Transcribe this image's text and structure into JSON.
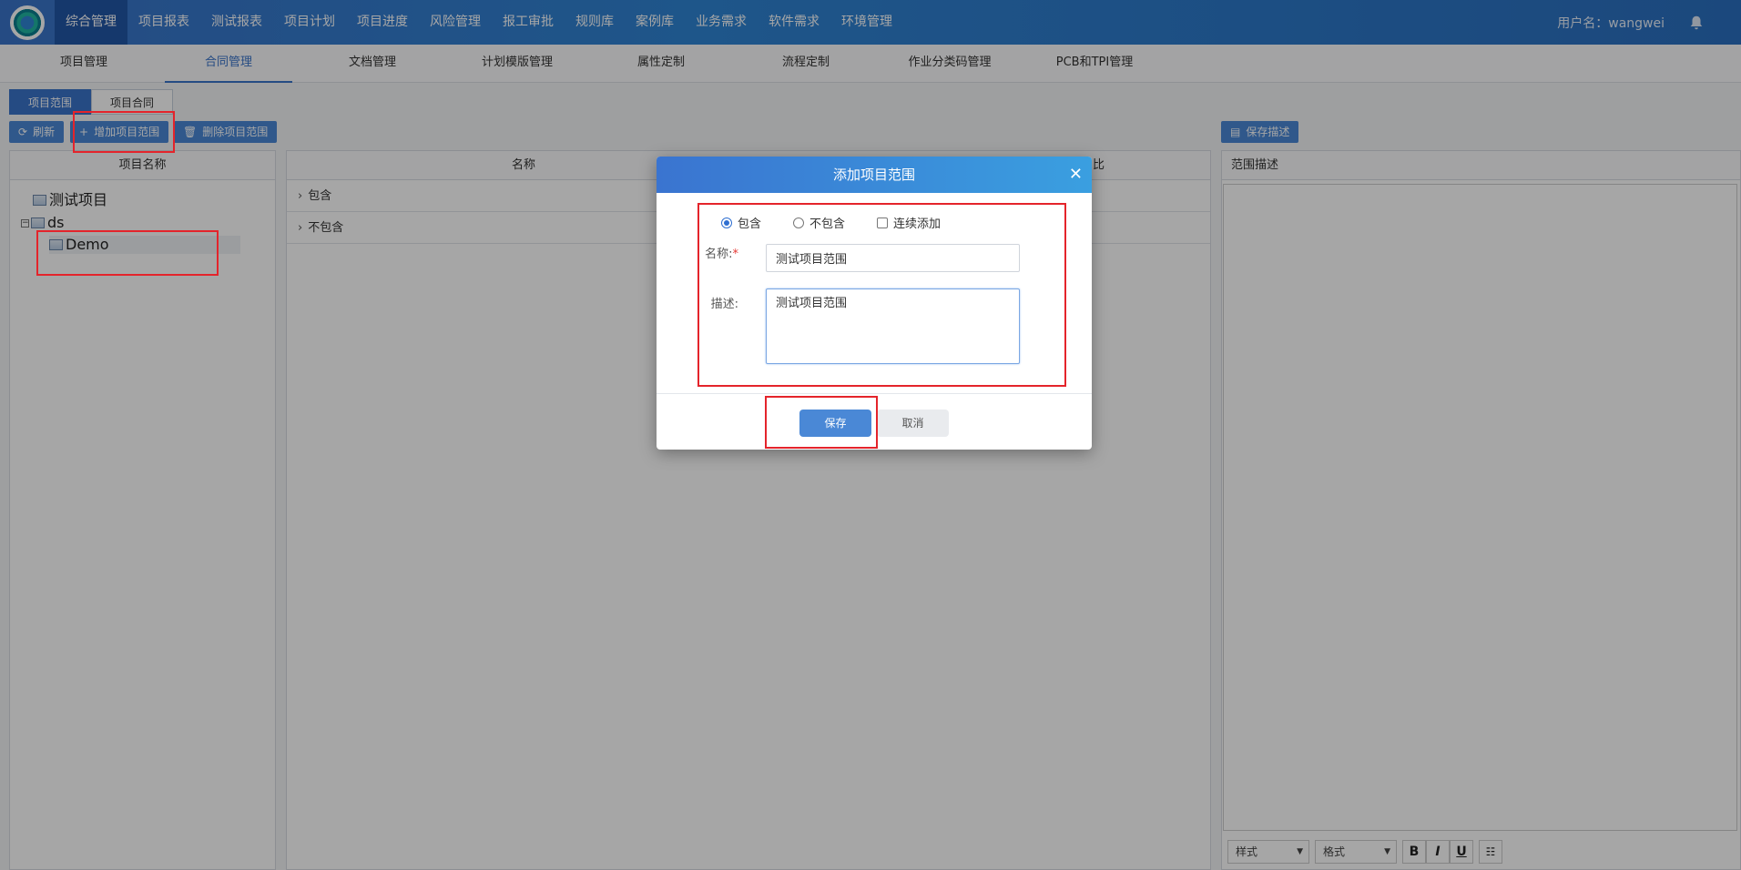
{
  "topnav": {
    "items": [
      "综合管理",
      "项目报表",
      "测试报表",
      "项目计划",
      "项目进度",
      "风险管理",
      "报工审批",
      "规则库",
      "案例库",
      "业务需求",
      "软件需求",
      "环境管理"
    ],
    "user_label": "用户名：wangwei"
  },
  "subnav": {
    "items": [
      "项目管理",
      "合同管理",
      "文档管理",
      "计划模版管理",
      "属性定制",
      "流程定制",
      "作业分类码管理",
      "PCB和TPI管理"
    ]
  },
  "tabs": [
    "项目范围",
    "项目合同"
  ],
  "toolbar": {
    "refresh": "刷新",
    "add": "增加项目范围",
    "delete": "删除项目范围",
    "save_desc": "保存描述"
  },
  "left_panel": {
    "header": "项目名称",
    "tree": [
      {
        "label": "测试项目"
      },
      {
        "label": "ds"
      },
      {
        "label": "Demo"
      }
    ]
  },
  "mid_panel": {
    "header": "名称",
    "header_right": "比",
    "rows": [
      "包含",
      "不包含"
    ]
  },
  "right_panel": {
    "header": "范围描述",
    "editor": {
      "style": "样式",
      "format": "格式",
      "bold": "B",
      "italic": "I",
      "underline": "U"
    }
  },
  "dialog": {
    "title": "添加项目范围",
    "options": {
      "include": "包含",
      "exclude": "不包含",
      "continuous": "连续添加"
    },
    "name_label": "名称:",
    "name_required": "*",
    "name_value": "测试项目范围",
    "desc_label": "描述:",
    "desc_value": "测试项目范围",
    "save": "保存",
    "cancel": "取消"
  }
}
